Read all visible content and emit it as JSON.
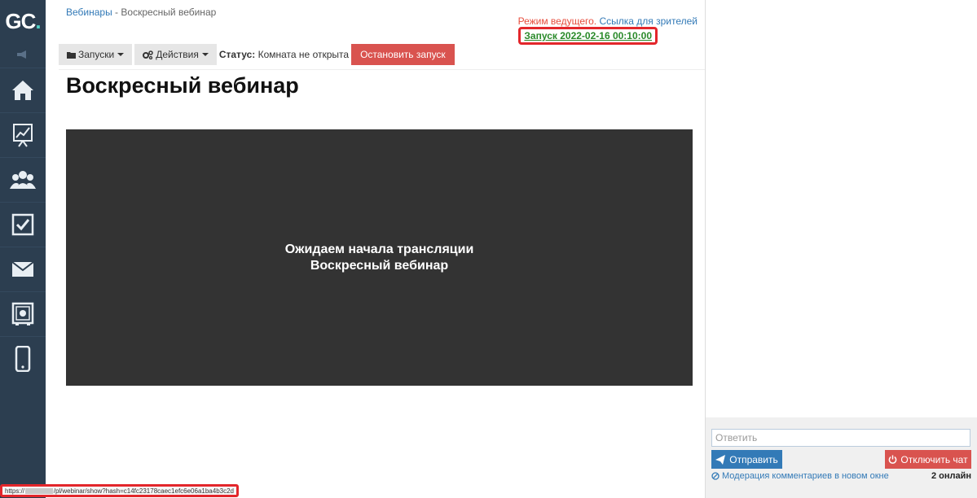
{
  "sidebar": {
    "logo_main": "GC",
    "logo_dot": ".",
    "items": [
      {
        "icon": "home-icon"
      },
      {
        "icon": "chart-icon"
      },
      {
        "icon": "users-icon"
      },
      {
        "icon": "checkbox-icon"
      },
      {
        "icon": "mail-icon"
      },
      {
        "icon": "safe-icon"
      },
      {
        "icon": "mobile-icon"
      }
    ]
  },
  "breadcrumb": {
    "link": "Вебинары",
    "separator": " - ",
    "current": "Воскресный вебинар"
  },
  "host": {
    "mode_text": "Режим ведущего.",
    "viewer_link": "Ссылка для зрителей",
    "launch_link": "Запуск 2022-02-16 00:10:00"
  },
  "toolbar": {
    "launches_label": "Запуски",
    "actions_label": "Действия",
    "status_label": "Статус:",
    "status_value": "Комната не открыта",
    "stop_label": "Остановить запуск"
  },
  "page": {
    "title": "Воскресный вебинар"
  },
  "player": {
    "line1": "Ожидаем начала трансляции",
    "line2": "Воскресный вебинар"
  },
  "chat": {
    "reply_placeholder": "Ответить",
    "send_label": "Отправить",
    "disable_label": "Отключить чат",
    "moderation_label": "Модерация комментариев в новом окне",
    "online_label": "2 онлайн"
  },
  "statusbar": {
    "url_prefix": "https://",
    "url_suffix": "/pl/webinar/show?hash=c14fc23178caec1efc6e06a1ba4b3c2d"
  },
  "colors": {
    "sidebar_bg": "#2c3e50",
    "link_blue": "#337ab7",
    "danger_red": "#d9534f",
    "launch_green": "#2a8a2a",
    "player_bg": "#333333"
  }
}
